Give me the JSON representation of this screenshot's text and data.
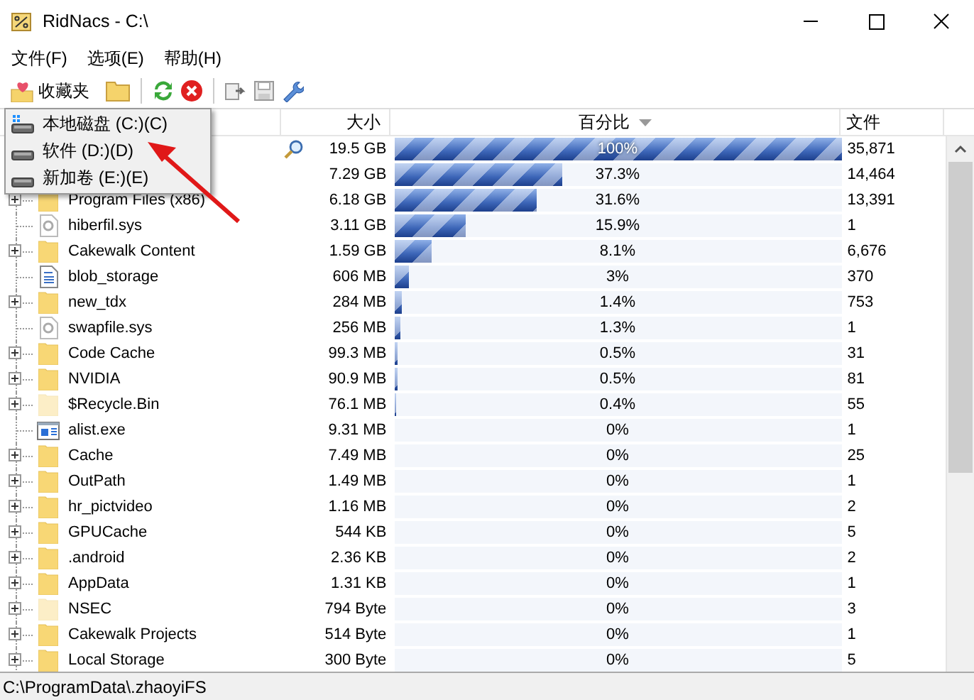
{
  "window": {
    "title": "RidNacs - C:\\"
  },
  "menu": [
    "文件(F)",
    "选项(E)",
    "帮助(H)"
  ],
  "toolbar": {
    "favorites_label": "收藏夹"
  },
  "drive_menu": [
    {
      "label": "本地磁盘 (C:)(C)",
      "kind": "system"
    },
    {
      "label": "软件 (D:)(D)",
      "kind": "drive"
    },
    {
      "label": "新加卷 (E:)(E)",
      "kind": "drive"
    }
  ],
  "table": {
    "columns": [
      {
        "label": "大小",
        "sorted": false
      },
      {
        "label": "百分比",
        "sorted": true
      },
      {
        "label": "文件",
        "sorted": false
      }
    ],
    "rows": [
      {
        "kind": "root",
        "size": "19.5 GB",
        "percent": "100%",
        "level": 1,
        "files": "35,871"
      },
      {
        "kind": "hidden-row",
        "size": "7.29 GB",
        "percent": "37.3%",
        "level": 0.373,
        "files": "14,464"
      },
      {
        "kind": "folder",
        "name": "Program Files (x86)",
        "hidden": false,
        "size": "6.18 GB",
        "percent": "31.6%",
        "level": 0.316,
        "files": "13,391"
      },
      {
        "kind": "system-file",
        "name": "hiberfil.sys",
        "size": "3.11 GB",
        "percent": "15.9%",
        "level": 0.159,
        "files": "1"
      },
      {
        "kind": "folder",
        "name": "Cakewalk Content",
        "hidden": false,
        "size": "1.59 GB",
        "percent": "8.1%",
        "level": 0.081,
        "files": "6,676"
      },
      {
        "kind": "document",
        "name": "blob_storage",
        "size": "606 MB",
        "percent": "3%",
        "level": 0.03,
        "files": "370"
      },
      {
        "kind": "folder",
        "name": "new_tdx",
        "hidden": false,
        "size": "284 MB",
        "percent": "1.4%",
        "level": 0.014,
        "files": "753"
      },
      {
        "kind": "system-file",
        "name": "swapfile.sys",
        "size": "256 MB",
        "percent": "1.3%",
        "level": 0.013,
        "files": "1"
      },
      {
        "kind": "folder",
        "name": "Code Cache",
        "hidden": false,
        "size": "99.3 MB",
        "percent": "0.5%",
        "level": 0.005,
        "files": "31"
      },
      {
        "kind": "folder",
        "name": "NVIDIA",
        "hidden": false,
        "size": "90.9 MB",
        "percent": "0.5%",
        "level": 0.005,
        "files": "81"
      },
      {
        "kind": "folder",
        "name": "$Recycle.Bin",
        "hidden": true,
        "size": "76.1 MB",
        "percent": "0.4%",
        "level": 0.004,
        "files": "55"
      },
      {
        "kind": "application",
        "name": "alist.exe",
        "size": "9.31 MB",
        "percent": "0%",
        "level": 0,
        "files": "1"
      },
      {
        "kind": "folder",
        "name": "Cache",
        "hidden": false,
        "size": "7.49 MB",
        "percent": "0%",
        "level": 0,
        "files": "25"
      },
      {
        "kind": "folder",
        "name": "OutPath",
        "hidden": false,
        "size": "1.49 MB",
        "percent": "0%",
        "level": 0,
        "files": "1"
      },
      {
        "kind": "folder",
        "name": "hr_pictvideo",
        "hidden": false,
        "size": "1.16 MB",
        "percent": "0%",
        "level": 0,
        "files": "2"
      },
      {
        "kind": "folder",
        "name": "GPUCache",
        "hidden": false,
        "size": "544 KB",
        "percent": "0%",
        "level": 0,
        "files": "5"
      },
      {
        "kind": "folder",
        "name": ".android",
        "hidden": false,
        "size": "2.36 KB",
        "percent": "0%",
        "level": 0,
        "files": "2"
      },
      {
        "kind": "folder",
        "name": "AppData",
        "hidden": false,
        "size": "1.31 KB",
        "percent": "0%",
        "level": 0,
        "files": "1"
      },
      {
        "kind": "folder",
        "name": "NSEC",
        "hidden": true,
        "size": "794 Byte",
        "percent": "0%",
        "level": 0,
        "files": "3"
      },
      {
        "kind": "folder",
        "name": "Cakewalk Projects",
        "hidden": false,
        "size": "514 Byte",
        "percent": "0%",
        "level": 0,
        "files": "1"
      },
      {
        "kind": "folder",
        "name": "Local Storage",
        "hidden": false,
        "size": "300 Byte",
        "percent": "0%",
        "level": 0,
        "files": "5"
      }
    ]
  },
  "status_bar": {
    "path": "C:\\ProgramData\\.zhaoyiFS"
  }
}
